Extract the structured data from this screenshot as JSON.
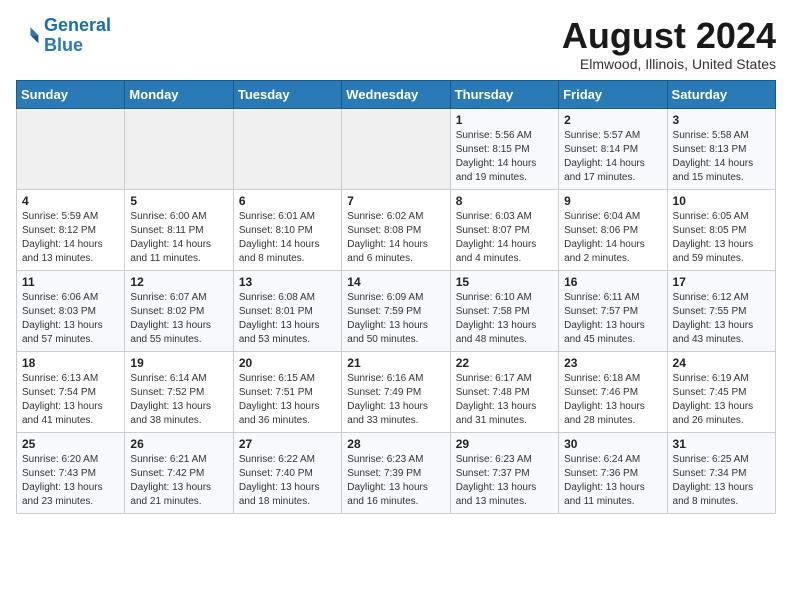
{
  "header": {
    "logo_line1": "General",
    "logo_line2": "Blue",
    "month_title": "August 2024",
    "location": "Elmwood, Illinois, United States"
  },
  "days_of_week": [
    "Sunday",
    "Monday",
    "Tuesday",
    "Wednesday",
    "Thursday",
    "Friday",
    "Saturday"
  ],
  "weeks": [
    [
      {
        "num": "",
        "sunrise": "",
        "sunset": "",
        "daylight": ""
      },
      {
        "num": "",
        "sunrise": "",
        "sunset": "",
        "daylight": ""
      },
      {
        "num": "",
        "sunrise": "",
        "sunset": "",
        "daylight": ""
      },
      {
        "num": "",
        "sunrise": "",
        "sunset": "",
        "daylight": ""
      },
      {
        "num": "1",
        "sunrise": "Sunrise: 5:56 AM",
        "sunset": "Sunset: 8:15 PM",
        "daylight": "Daylight: 14 hours and 19 minutes."
      },
      {
        "num": "2",
        "sunrise": "Sunrise: 5:57 AM",
        "sunset": "Sunset: 8:14 PM",
        "daylight": "Daylight: 14 hours and 17 minutes."
      },
      {
        "num": "3",
        "sunrise": "Sunrise: 5:58 AM",
        "sunset": "Sunset: 8:13 PM",
        "daylight": "Daylight: 14 hours and 15 minutes."
      }
    ],
    [
      {
        "num": "4",
        "sunrise": "Sunrise: 5:59 AM",
        "sunset": "Sunset: 8:12 PM",
        "daylight": "Daylight: 14 hours and 13 minutes."
      },
      {
        "num": "5",
        "sunrise": "Sunrise: 6:00 AM",
        "sunset": "Sunset: 8:11 PM",
        "daylight": "Daylight: 14 hours and 11 minutes."
      },
      {
        "num": "6",
        "sunrise": "Sunrise: 6:01 AM",
        "sunset": "Sunset: 8:10 PM",
        "daylight": "Daylight: 14 hours and 8 minutes."
      },
      {
        "num": "7",
        "sunrise": "Sunrise: 6:02 AM",
        "sunset": "Sunset: 8:08 PM",
        "daylight": "Daylight: 14 hours and 6 minutes."
      },
      {
        "num": "8",
        "sunrise": "Sunrise: 6:03 AM",
        "sunset": "Sunset: 8:07 PM",
        "daylight": "Daylight: 14 hours and 4 minutes."
      },
      {
        "num": "9",
        "sunrise": "Sunrise: 6:04 AM",
        "sunset": "Sunset: 8:06 PM",
        "daylight": "Daylight: 14 hours and 2 minutes."
      },
      {
        "num": "10",
        "sunrise": "Sunrise: 6:05 AM",
        "sunset": "Sunset: 8:05 PM",
        "daylight": "Daylight: 13 hours and 59 minutes."
      }
    ],
    [
      {
        "num": "11",
        "sunrise": "Sunrise: 6:06 AM",
        "sunset": "Sunset: 8:03 PM",
        "daylight": "Daylight: 13 hours and 57 minutes."
      },
      {
        "num": "12",
        "sunrise": "Sunrise: 6:07 AM",
        "sunset": "Sunset: 8:02 PM",
        "daylight": "Daylight: 13 hours and 55 minutes."
      },
      {
        "num": "13",
        "sunrise": "Sunrise: 6:08 AM",
        "sunset": "Sunset: 8:01 PM",
        "daylight": "Daylight: 13 hours and 53 minutes."
      },
      {
        "num": "14",
        "sunrise": "Sunrise: 6:09 AM",
        "sunset": "Sunset: 7:59 PM",
        "daylight": "Daylight: 13 hours and 50 minutes."
      },
      {
        "num": "15",
        "sunrise": "Sunrise: 6:10 AM",
        "sunset": "Sunset: 7:58 PM",
        "daylight": "Daylight: 13 hours and 48 minutes."
      },
      {
        "num": "16",
        "sunrise": "Sunrise: 6:11 AM",
        "sunset": "Sunset: 7:57 PM",
        "daylight": "Daylight: 13 hours and 45 minutes."
      },
      {
        "num": "17",
        "sunrise": "Sunrise: 6:12 AM",
        "sunset": "Sunset: 7:55 PM",
        "daylight": "Daylight: 13 hours and 43 minutes."
      }
    ],
    [
      {
        "num": "18",
        "sunrise": "Sunrise: 6:13 AM",
        "sunset": "Sunset: 7:54 PM",
        "daylight": "Daylight: 13 hours and 41 minutes."
      },
      {
        "num": "19",
        "sunrise": "Sunrise: 6:14 AM",
        "sunset": "Sunset: 7:52 PM",
        "daylight": "Daylight: 13 hours and 38 minutes."
      },
      {
        "num": "20",
        "sunrise": "Sunrise: 6:15 AM",
        "sunset": "Sunset: 7:51 PM",
        "daylight": "Daylight: 13 hours and 36 minutes."
      },
      {
        "num": "21",
        "sunrise": "Sunrise: 6:16 AM",
        "sunset": "Sunset: 7:49 PM",
        "daylight": "Daylight: 13 hours and 33 minutes."
      },
      {
        "num": "22",
        "sunrise": "Sunrise: 6:17 AM",
        "sunset": "Sunset: 7:48 PM",
        "daylight": "Daylight: 13 hours and 31 minutes."
      },
      {
        "num": "23",
        "sunrise": "Sunrise: 6:18 AM",
        "sunset": "Sunset: 7:46 PM",
        "daylight": "Daylight: 13 hours and 28 minutes."
      },
      {
        "num": "24",
        "sunrise": "Sunrise: 6:19 AM",
        "sunset": "Sunset: 7:45 PM",
        "daylight": "Daylight: 13 hours and 26 minutes."
      }
    ],
    [
      {
        "num": "25",
        "sunrise": "Sunrise: 6:20 AM",
        "sunset": "Sunset: 7:43 PM",
        "daylight": "Daylight: 13 hours and 23 minutes."
      },
      {
        "num": "26",
        "sunrise": "Sunrise: 6:21 AM",
        "sunset": "Sunset: 7:42 PM",
        "daylight": "Daylight: 13 hours and 21 minutes."
      },
      {
        "num": "27",
        "sunrise": "Sunrise: 6:22 AM",
        "sunset": "Sunset: 7:40 PM",
        "daylight": "Daylight: 13 hours and 18 minutes."
      },
      {
        "num": "28",
        "sunrise": "Sunrise: 6:23 AM",
        "sunset": "Sunset: 7:39 PM",
        "daylight": "Daylight: 13 hours and 16 minutes."
      },
      {
        "num": "29",
        "sunrise": "Sunrise: 6:23 AM",
        "sunset": "Sunset: 7:37 PM",
        "daylight": "Daylight: 13 hours and 13 minutes."
      },
      {
        "num": "30",
        "sunrise": "Sunrise: 6:24 AM",
        "sunset": "Sunset: 7:36 PM",
        "daylight": "Daylight: 13 hours and 11 minutes."
      },
      {
        "num": "31",
        "sunrise": "Sunrise: 6:25 AM",
        "sunset": "Sunset: 7:34 PM",
        "daylight": "Daylight: 13 hours and 8 minutes."
      }
    ]
  ]
}
